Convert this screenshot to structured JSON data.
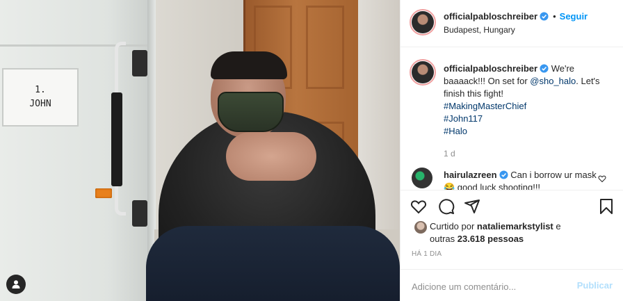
{
  "photo": {
    "name_plate_line1": "1.",
    "name_plate_line2": "JOHN"
  },
  "header": {
    "username": "officialpabloschreiber",
    "follow_separator": "•",
    "follow_label": "Seguir",
    "location": "Budapest, Hungary"
  },
  "caption": {
    "username": "officialpabloschreiber",
    "text_before": " We're baaaack!!! On set for ",
    "mention": "@sho_halo",
    "text_after": ". Let's finish this fight!",
    "hashtags": [
      "#MakingMasterChief",
      "#John117",
      "#Halo"
    ],
    "time": "1 d"
  },
  "comment": {
    "username": "hairulazreen",
    "text": " Can i borrow ur mask😂 good luck shooting!!!"
  },
  "likes": {
    "prefix": "Curtido por ",
    "user": "nataliemarkstylist",
    "middle": " e",
    "second_line_prefix": "outras ",
    "count": "23.618",
    "suffix": " pessoas"
  },
  "post_time": "HÁ 1 DIA",
  "comment_box": {
    "placeholder": "Adicione um comentário...",
    "publish_label": "Publicar"
  },
  "colors": {
    "accent": "#0095f6",
    "link": "#00376b",
    "muted": "#8e8e8e",
    "publish_disabled": "#b2dffc"
  }
}
